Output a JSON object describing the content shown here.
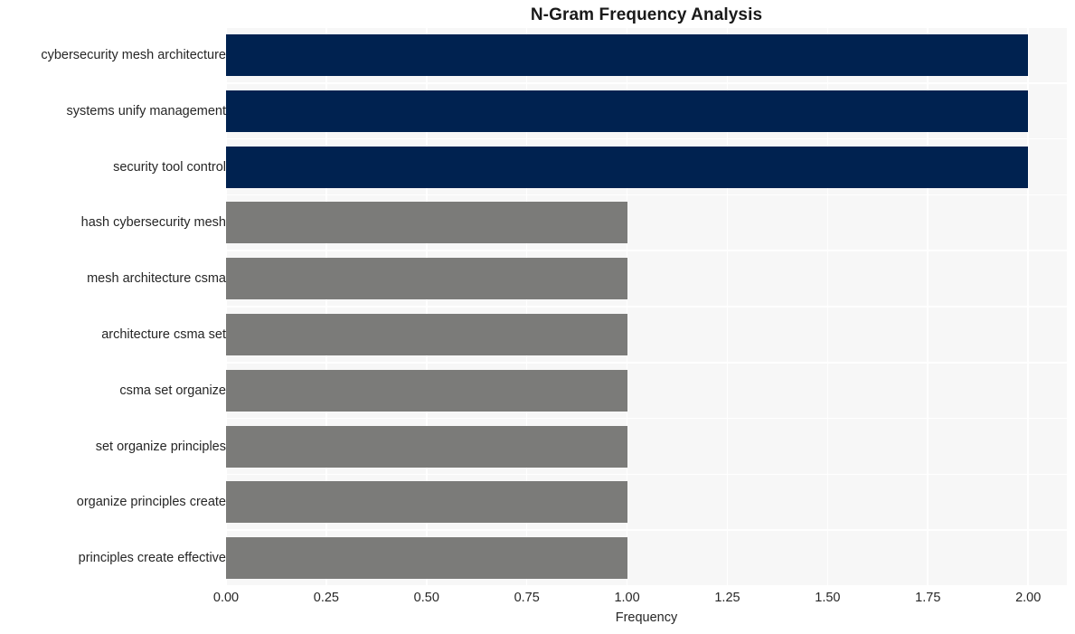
{
  "chart_data": {
    "type": "bar",
    "orientation": "horizontal",
    "title": "N-Gram Frequency Analysis",
    "xlabel": "Frequency",
    "ylabel": "",
    "categories": [
      "cybersecurity mesh architecture",
      "systems unify management",
      "security tool control",
      "hash cybersecurity mesh",
      "mesh architecture csma",
      "architecture csma set",
      "csma set organize",
      "set organize principles",
      "organize principles create",
      "principles create effective"
    ],
    "values": [
      2,
      2,
      2,
      1,
      1,
      1,
      1,
      1,
      1,
      1
    ],
    "bar_colors": [
      "#002250",
      "#002250",
      "#002250",
      "#7b7b79",
      "#7b7b79",
      "#7b7b79",
      "#7b7b79",
      "#7b7b79",
      "#7b7b79",
      "#7b7b79"
    ],
    "xlim": [
      0.0,
      2.0965
    ],
    "xticks": [
      0.0,
      0.25,
      0.5,
      0.75,
      1.0,
      1.25,
      1.5,
      1.75,
      2.0
    ],
    "xtick_labels": [
      "0.00",
      "0.25",
      "0.50",
      "0.75",
      "1.00",
      "1.25",
      "1.50",
      "1.75",
      "2.00"
    ],
    "grid": true,
    "grid_color": "#ffffff",
    "plot_background": "#f7f7f7",
    "figure_background": "#ffffff",
    "legend": null,
    "highlight_color": "#002250",
    "base_color": "#7b7b79"
  }
}
